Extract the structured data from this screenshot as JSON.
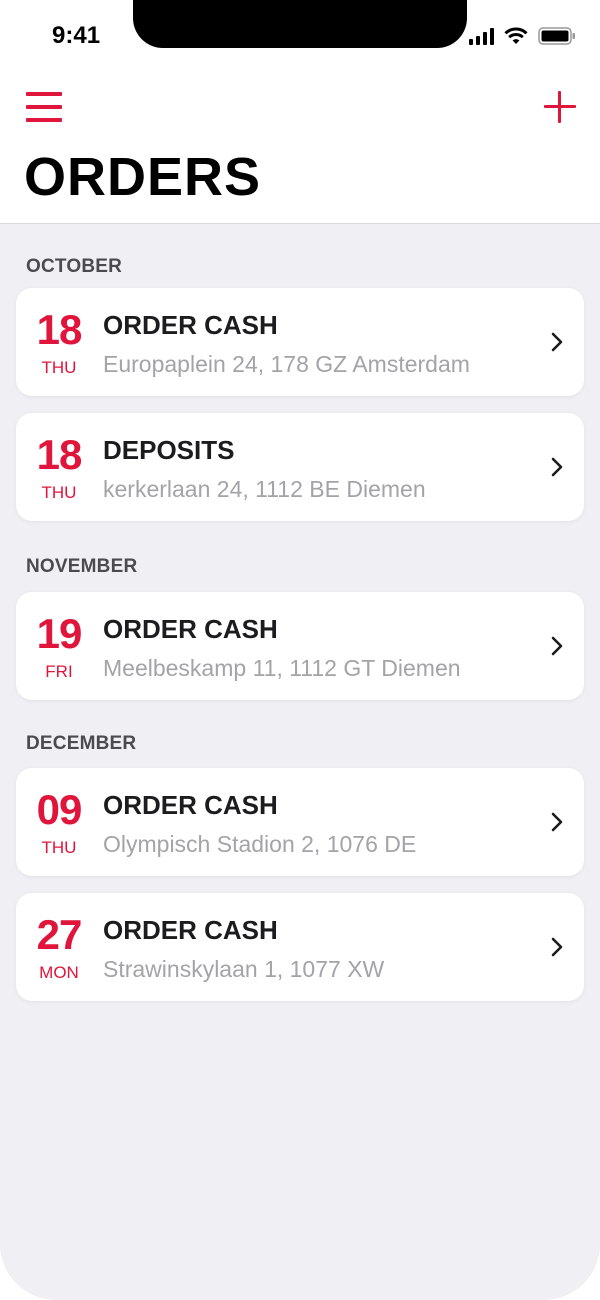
{
  "status_bar": {
    "time": "9:41"
  },
  "header": {
    "title": "ORDERS",
    "menu_icon": "hamburger-menu-icon",
    "add_icon": "plus-icon"
  },
  "colors": {
    "accent": "#e0153b",
    "background": "#efeff4",
    "card": "#ffffff",
    "address_text": "#a3a3a8"
  },
  "sections": [
    {
      "month": "OCTOBER",
      "orders": [
        {
          "day": "18",
          "weekday": "THU",
          "title": "ORDER CASH",
          "address": "Europaplein 24, 178 GZ Amsterdam"
        },
        {
          "day": "18",
          "weekday": "THU",
          "title": "DEPOSITS",
          "address": "kerkerlaan 24, 1112 BE Diemen"
        }
      ]
    },
    {
      "month": "NOVEMBER",
      "orders": [
        {
          "day": "19",
          "weekday": "FRI",
          "title": "ORDER CASH",
          "address": "Meelbeskamp 11, 1112 GT Diemen"
        }
      ]
    },
    {
      "month": "DECEMBER",
      "orders": [
        {
          "day": "09",
          "weekday": "THU",
          "title": "ORDER CASH",
          "address": "Olympisch Stadion 2, 1076 DE"
        },
        {
          "day": "27",
          "weekday": "MON",
          "title": "ORDER CASH",
          "address": "Strawinskylaan 1, 1077 XW"
        }
      ]
    }
  ]
}
